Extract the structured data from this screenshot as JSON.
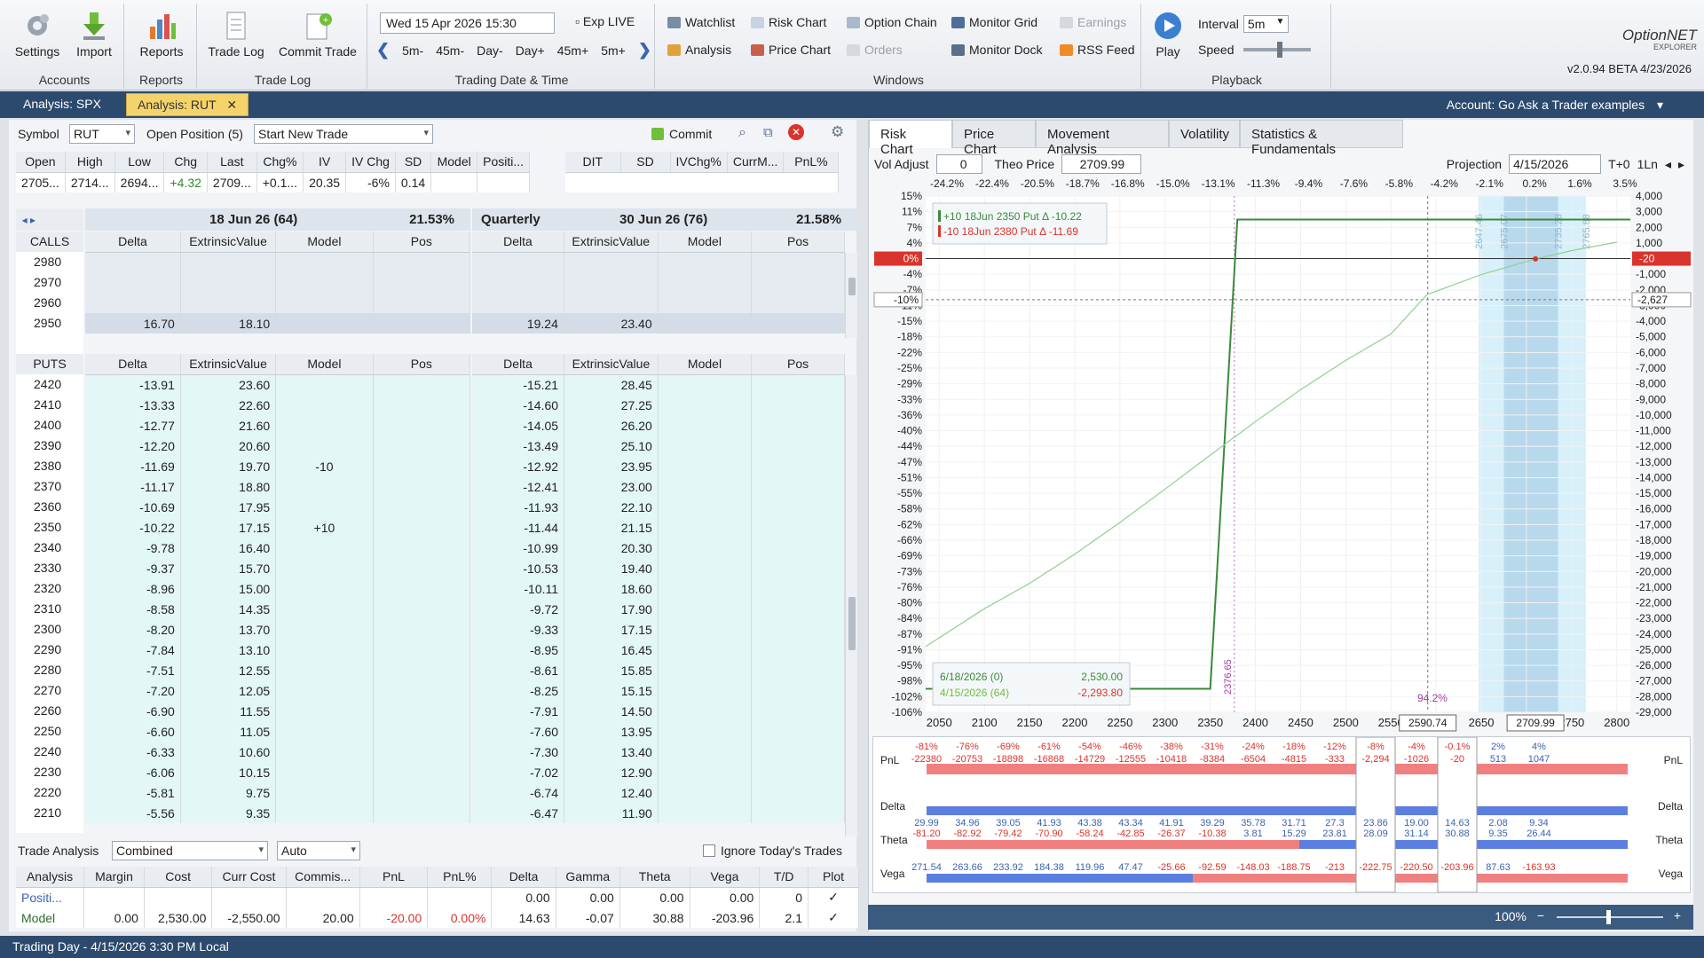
{
  "ribbon": {
    "settings": "Settings",
    "import": "Import",
    "accounts": "Accounts",
    "reports_btn": "Reports",
    "reports_group": "Reports",
    "trade_log_btn": "Trade Log",
    "commit_trade": "Commit Trade",
    "trade_log_group": "Trade Log",
    "date_value": "Wed 15 Apr 2026 15:30",
    "exp_live": "Exp LIVE",
    "steps": [
      "5m-",
      "45m-",
      "Day-",
      "Day+",
      "45m+",
      "5m+"
    ],
    "date_group": "Trading Date & Time",
    "windows": [
      "Watchlist",
      "Risk Chart",
      "Option Chain",
      "Monitor Grid",
      "Earnings",
      "Analysis",
      "Price Chart",
      "Orders",
      "Monitor Dock",
      "RSS Feed"
    ],
    "windows_group": "Windows",
    "play": "Play",
    "interval_label": "Interval",
    "interval_value": "5m",
    "speed_label": "Speed",
    "playback_group": "Playback",
    "brand": "OptionNET",
    "brand_sub": "EXPLORER",
    "version": "v2.0.94 BETA 4/23/2026"
  },
  "tabs": [
    {
      "label": "Analysis: SPX"
    },
    {
      "label": "Analysis: RUT"
    }
  ],
  "account": "Account: Go Ask a Trader examples",
  "left": {
    "symbol_label": "Symbol",
    "symbol_value": "RUT",
    "open_position": "Open Position (5)",
    "trade_select": "Start New Trade",
    "commit": "Commit",
    "quote_headers": [
      "Open",
      "High",
      "Low",
      "Chg",
      "Last",
      "Chg%",
      "IV",
      "IV Chg",
      "SD",
      "Model",
      "Positi..."
    ],
    "quote_values": [
      "2705...",
      "2714...",
      "2694...",
      "+4.32",
      "2709...",
      "+0.1...",
      "20.35",
      "-6%",
      "0.14",
      "",
      ""
    ],
    "quote2_headers": [
      "DIT",
      "SD",
      "IVChg%",
      "CurrM...",
      "PnL%"
    ],
    "exp1": "18 Jun 26 (64)",
    "exp1_iv": "21.53%",
    "exp2_label": "Quarterly",
    "exp2": "30 Jun 26 (76)",
    "exp2_iv": "21.58%",
    "calls_label": "CALLS",
    "puts_label": "PUTS",
    "col_headers": [
      "Delta",
      "ExtrinsicValue",
      "Model",
      "Pos"
    ],
    "calls": [
      {
        "k": "2980",
        "d1": "",
        "e1": "",
        "d2": "",
        "e2": ""
      },
      {
        "k": "2970",
        "d1": "",
        "e1": "",
        "d2": "",
        "e2": ""
      },
      {
        "k": "2960",
        "d1": "",
        "e1": "",
        "d2": "",
        "e2": ""
      },
      {
        "k": "2950",
        "d1": "16.70",
        "e1": "18.10",
        "d2": "19.24",
        "e2": "23.40"
      }
    ],
    "puts": [
      {
        "k": "2420",
        "d1": "-13.91",
        "e1": "23.60",
        "m": "",
        "d2": "-15.21",
        "e2": "28.45"
      },
      {
        "k": "2410",
        "d1": "-13.33",
        "e1": "22.60",
        "m": "",
        "d2": "-14.60",
        "e2": "27.25"
      },
      {
        "k": "2400",
        "d1": "-12.77",
        "e1": "21.60",
        "m": "",
        "d2": "-14.05",
        "e2": "26.20"
      },
      {
        "k": "2390",
        "d1": "-12.20",
        "e1": "20.60",
        "m": "",
        "d2": "-13.49",
        "e2": "25.10"
      },
      {
        "k": "2380",
        "d1": "-11.69",
        "e1": "19.70",
        "m": "-10",
        "d2": "-12.92",
        "e2": "23.95"
      },
      {
        "k": "2370",
        "d1": "-11.17",
        "e1": "18.80",
        "m": "",
        "d2": "-12.41",
        "e2": "23.00"
      },
      {
        "k": "2360",
        "d1": "-10.69",
        "e1": "17.95",
        "m": "",
        "d2": "-11.93",
        "e2": "22.10"
      },
      {
        "k": "2350",
        "d1": "-10.22",
        "e1": "17.15",
        "m": "+10",
        "d2": "-11.44",
        "e2": "21.15"
      },
      {
        "k": "2340",
        "d1": "-9.78",
        "e1": "16.40",
        "m": "",
        "d2": "-10.99",
        "e2": "20.30"
      },
      {
        "k": "2330",
        "d1": "-9.37",
        "e1": "15.70",
        "m": "",
        "d2": "-10.53",
        "e2": "19.40"
      },
      {
        "k": "2320",
        "d1": "-8.96",
        "e1": "15.00",
        "m": "",
        "d2": "-10.11",
        "e2": "18.60"
      },
      {
        "k": "2310",
        "d1": "-8.58",
        "e1": "14.35",
        "m": "",
        "d2": "-9.72",
        "e2": "17.90"
      },
      {
        "k": "2300",
        "d1": "-8.20",
        "e1": "13.70",
        "m": "",
        "d2": "-9.33",
        "e2": "17.15"
      },
      {
        "k": "2290",
        "d1": "-7.84",
        "e1": "13.10",
        "m": "",
        "d2": "-8.95",
        "e2": "16.45"
      },
      {
        "k": "2280",
        "d1": "-7.51",
        "e1": "12.55",
        "m": "",
        "d2": "-8.61",
        "e2": "15.85"
      },
      {
        "k": "2270",
        "d1": "-7.20",
        "e1": "12.05",
        "m": "",
        "d2": "-8.25",
        "e2": "15.15"
      },
      {
        "k": "2260",
        "d1": "-6.90",
        "e1": "11.55",
        "m": "",
        "d2": "-7.91",
        "e2": "14.50"
      },
      {
        "k": "2250",
        "d1": "-6.60",
        "e1": "11.05",
        "m": "",
        "d2": "-7.60",
        "e2": "13.95"
      },
      {
        "k": "2240",
        "d1": "-6.33",
        "e1": "10.60",
        "m": "",
        "d2": "-7.30",
        "e2": "13.40"
      },
      {
        "k": "2230",
        "d1": "-6.06",
        "e1": "10.15",
        "m": "",
        "d2": "-7.02",
        "e2": "12.90"
      },
      {
        "k": "2220",
        "d1": "-5.81",
        "e1": "9.75",
        "m": "",
        "d2": "-6.74",
        "e2": "12.40"
      },
      {
        "k": "2210",
        "d1": "-5.56",
        "e1": "9.35",
        "m": "",
        "d2": "-6.47",
        "e2": "11.90"
      }
    ],
    "trade_analysis_label": "Trade Analysis",
    "ta_mode": "Combined",
    "ta_auto": "Auto",
    "ignore_today": "Ignore Today's Trades",
    "ta_headers": [
      "Analysis",
      "Margin",
      "Cost",
      "Curr Cost",
      "Commis...",
      "PnL",
      "PnL%",
      "Delta",
      "Gamma",
      "Theta",
      "Vega",
      "T/D",
      "Plot"
    ],
    "ta_rows": [
      [
        "Positi...",
        "",
        "",
        "",
        "",
        "",
        "",
        "0.00",
        "0.00",
        "0.00",
        "0.00",
        "0",
        "✓"
      ],
      [
        "Model",
        "0.00",
        "2,530.00",
        "-2,550.00",
        "20.00",
        "-20.00",
        "0.00%",
        "14.63",
        "-0.07",
        "30.88",
        "-203.96",
        "2.1",
        "✓"
      ]
    ]
  },
  "right": {
    "tabs": [
      "Risk Chart",
      "Price Chart",
      "Movement Analysis",
      "Volatility",
      "Statistics & Fundamentals"
    ],
    "vol_adjust_label": "Vol Adjust",
    "vol_adjust": "0",
    "theo_label": "Theo Price",
    "theo_value": "2709.99",
    "projection_label": "Projection",
    "projection": "4/15/2026",
    "tplus": "T+0",
    "ln": "1Ln",
    "top_pct": [
      "-24.2%",
      "-22.4%",
      "-20.5%",
      "-18.7%",
      "-16.8%",
      "-15.0%",
      "-13.1%",
      "-11.3%",
      "-9.4%",
      "-7.6%",
      "-5.8%",
      "-4.2%",
      "-2.1%",
      "0.2%",
      "1.6%",
      "3.5%"
    ],
    "legend": [
      "+10 18Jun 2350 Put Δ  -10.22",
      "-10 18Jun 2380 Put Δ  -11.69"
    ],
    "tooltip": {
      "r1_label": "6/18/2026 (0)",
      "r1_val": "2,530.00",
      "r2_label": "4/15/2026 (64)",
      "r2_val": "-2,293.80"
    },
    "sd_labels": [
      "2647.46",
      "2675.07",
      "2735.28",
      "2765.88"
    ],
    "crosshair_x": "2590.74",
    "price_label": "2709.99",
    "strike_marker": "2376.65",
    "pct_marker": "94.2%",
    "zero_label": "0%",
    "zero_right": "-20",
    "cross_pct": "-10%",
    "cross_val": "-2,627",
    "bottom_rows": {
      "pnl_pct": [
        "-81%",
        "-76%",
        "-69%",
        "-61%",
        "-54%",
        "-46%",
        "-38%",
        "-31%",
        "-24%",
        "-18%",
        "-12%",
        "-8%",
        "-4%",
        "-0.1%",
        "2%",
        "4%"
      ],
      "pnl": [
        "-22380",
        "-20753",
        "-18898",
        "-16868",
        "-14729",
        "-12555",
        "-10418",
        "-8384",
        "-6504",
        "-4815",
        "-333",
        "-2,294",
        "-1026",
        "-20",
        "513",
        "1047"
      ],
      "delta": [
        "29.99",
        "34.96",
        "39.05",
        "41.93",
        "43.38",
        "43.34",
        "41.91",
        "39.29",
        "35.78",
        "31.71",
        "27.3",
        "23.86",
        "19.00",
        "14.63",
        "2.08",
        "9.34"
      ],
      "theta": [
        "-81.20",
        "-82.92",
        "-79.42",
        "-70.90",
        "-58.24",
        "-42.85",
        "-26.37",
        "-10.38",
        "3.81",
        "15.29",
        "23.81",
        "28.09",
        "31.14",
        "30.88",
        "9.35",
        "26.44"
      ],
      "vega": [
        "271.54",
        "263.66",
        "233.92",
        "184.38",
        "119.96",
        "47.47",
        "-25.66",
        "-92.59",
        "-148.03",
        "-188.75",
        "-213",
        "-222.75",
        "-220.50",
        "-203.96",
        "87.63",
        "-163.93"
      ]
    },
    "row_labels": [
      "PnL",
      "Delta",
      "Theta",
      "Vega"
    ],
    "zoom": "100%"
  },
  "status": "Trading Day - 4/15/2026 3:30 PM Local",
  "chart_data": {
    "type": "line",
    "x_ticks": [
      2050,
      2100,
      2150,
      2200,
      2250,
      2300,
      2350,
      2400,
      2450,
      2500,
      2550,
      2600,
      2650,
      2700,
      2750,
      2800
    ],
    "xlim": [
      2035,
      2815
    ],
    "y_left_ticks": [
      "15%",
      "11%",
      "7%",
      "4%",
      "0%",
      "-4%",
      "-7%",
      "-11%",
      "-15%",
      "-18%",
      "-22%",
      "-25%",
      "-29%",
      "-33%",
      "-36%",
      "-40%",
      "-44%",
      "-47%",
      "-51%",
      "-55%",
      "-58%",
      "-62%",
      "-66%",
      "-69%",
      "-73%",
      "-76%",
      "-80%",
      "-84%",
      "-87%",
      "-91%",
      "-95%",
      "-98%",
      "-102%",
      "-106%"
    ],
    "y_right_ticks": [
      "4,000",
      "3,000",
      "2,000",
      "1,000",
      "0",
      "-1,000",
      "-2,000",
      "-3,000",
      "-4,000",
      "-5,000",
      "-6,000",
      "-7,000",
      "-8,000",
      "-9,000",
      "-10,000",
      "-11,000",
      "-12,000",
      "-13,000",
      "-14,000",
      "-15,000",
      "-16,000",
      "-17,000",
      "-18,000",
      "-19,000",
      "-20,000",
      "-21,000",
      "-22,000",
      "-23,000",
      "-24,000",
      "-25,000",
      "-26,000",
      "-27,000",
      "-28,000",
      "-29,000"
    ],
    "ylim": [
      -29000,
      4000
    ],
    "series": [
      {
        "points": [
          [
            2035,
            -27500
          ],
          [
            2335,
            -27500
          ],
          [
            2350,
            -27500
          ],
          [
            2380,
            2500
          ],
          [
            2815,
            2500
          ]
        ],
        "color": "#3a8a3a"
      },
      {
        "points": [
          [
            2035,
            -24800
          ],
          [
            2100,
            -22380
          ],
          [
            2150,
            -20753
          ],
          [
            2200,
            -18898
          ],
          [
            2250,
            -16868
          ],
          [
            2300,
            -14729
          ],
          [
            2350,
            -12555
          ],
          [
            2400,
            -10418
          ],
          [
            2450,
            -8384
          ],
          [
            2500,
            -6504
          ],
          [
            2550,
            -4815
          ],
          [
            2590,
            -2294
          ],
          [
            2650,
            -1026
          ],
          [
            2710,
            -20
          ],
          [
            2750,
            513
          ],
          [
            2800,
            1047
          ]
        ],
        "color": "#8fd18f"
      }
    ]
  }
}
